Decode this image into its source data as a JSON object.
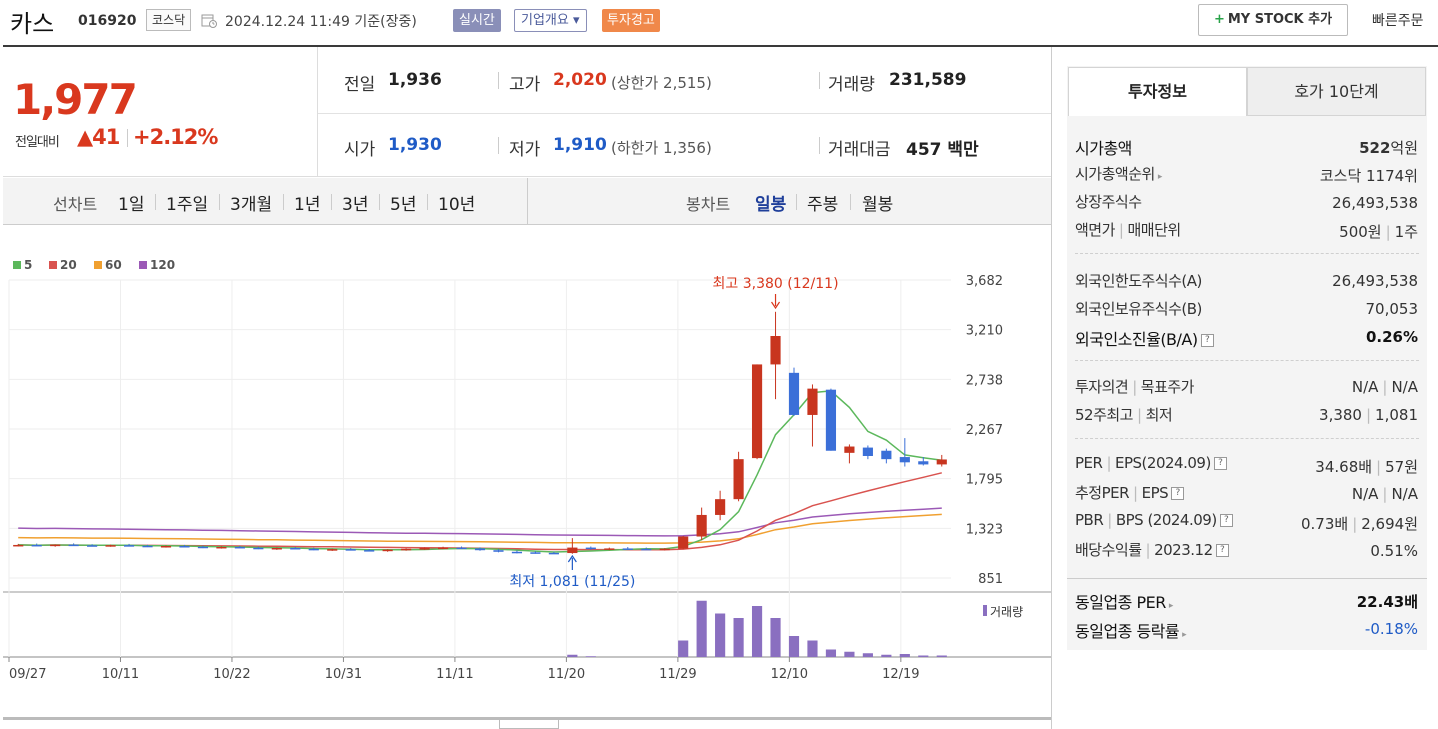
{
  "header": {
    "company_name": "카스",
    "company_code": "016920",
    "market": "코스닥",
    "datetime": "2024.12.24 11:49  기준(장중)",
    "realtime_label": "실시간",
    "overview_label": "기업개요 ▾",
    "warning_label": "투자경고",
    "mystock_label": "MY STOCK 추가",
    "quick_order_label": "빠른주문"
  },
  "price": {
    "current": "1,977",
    "change_label": "전일대비",
    "change_amount": "▲41",
    "change_percent": "+2.12%",
    "prev_close_label": "전일",
    "prev_close": "1,936",
    "high_label": "고가",
    "high": "2,020",
    "upper_limit": "(상한가 2,515)",
    "volume_label": "거래량",
    "volume": "231,589",
    "open_label": "시가",
    "open": "1,930",
    "low_label": "저가",
    "low": "1,910",
    "lower_limit": "(하한가 1,356)",
    "amount_label": "거래대금",
    "amount": "457 백만"
  },
  "chart_tabs": {
    "line_label": "선차트",
    "periods": [
      "1일",
      "1주일",
      "3개월",
      "1년",
      "3년",
      "5년",
      "10년"
    ],
    "candle_label": "봉차트",
    "candle_periods": [
      "일봉",
      "주봉",
      "월봉"
    ],
    "active_candle": "일봉"
  },
  "chart_data": {
    "type": "candlestick",
    "legend": [
      {
        "name": "5",
        "color": "#5cb85c"
      },
      {
        "name": "20",
        "color": "#d9534f"
      },
      {
        "name": "60",
        "color": "#f0a030"
      },
      {
        "name": "120",
        "color": "#9b59b6"
      }
    ],
    "y_ticks": [
      "3,682",
      "3,210",
      "2,738",
      "2,267",
      "1,795",
      "1,323",
      "851"
    ],
    "ylim": [
      851,
      3682
    ],
    "x_ticks": [
      "09/27",
      "10/11",
      "10/22",
      "10/31",
      "11/11",
      "11/20",
      "11/29",
      "12/10",
      "12/19"
    ],
    "annotation_high": "최고 3,380 (12/11)",
    "annotation_low": "최저 1,081 (11/25)",
    "volume_label": "거래량",
    "candles": [
      [
        1160,
        1175,
        1150,
        1165
      ],
      [
        1165,
        1178,
        1155,
        1160
      ],
      [
        1160,
        1170,
        1148,
        1168
      ],
      [
        1168,
        1180,
        1160,
        1162
      ],
      [
        1162,
        1172,
        1150,
        1158
      ],
      [
        1158,
        1168,
        1148,
        1163
      ],
      [
        1163,
        1175,
        1155,
        1157
      ],
      [
        1157,
        1166,
        1145,
        1150
      ],
      [
        1150,
        1160,
        1140,
        1155
      ],
      [
        1155,
        1165,
        1145,
        1148
      ],
      [
        1148,
        1158,
        1135,
        1142
      ],
      [
        1142,
        1152,
        1130,
        1146
      ],
      [
        1146,
        1156,
        1136,
        1138
      ],
      [
        1138,
        1148,
        1125,
        1130
      ],
      [
        1130,
        1140,
        1118,
        1136
      ],
      [
        1136,
        1145,
        1125,
        1128
      ],
      [
        1128,
        1138,
        1115,
        1120
      ],
      [
        1120,
        1130,
        1108,
        1125
      ],
      [
        1125,
        1135,
        1112,
        1116
      ],
      [
        1116,
        1126,
        1105,
        1112
      ],
      [
        1112,
        1125,
        1100,
        1120
      ],
      [
        1120,
        1132,
        1110,
        1128
      ],
      [
        1128,
        1140,
        1118,
        1135
      ],
      [
        1135,
        1148,
        1125,
        1140
      ],
      [
        1140,
        1150,
        1128,
        1132
      ],
      [
        1132,
        1142,
        1110,
        1115
      ],
      [
        1115,
        1125,
        1095,
        1100
      ],
      [
        1100,
        1112,
        1085,
        1095
      ],
      [
        1095,
        1105,
        1082,
        1090
      ],
      [
        1090,
        1100,
        1081,
        1088
      ],
      [
        1088,
        1230,
        1081,
        1140
      ],
      [
        1140,
        1150,
        1120,
        1125
      ],
      [
        1125,
        1140,
        1115,
        1132
      ],
      [
        1132,
        1145,
        1120,
        1128
      ],
      [
        1128,
        1140,
        1118,
        1122
      ],
      [
        1122,
        1135,
        1112,
        1130
      ],
      [
        1130,
        1250,
        1125,
        1245
      ],
      [
        1245,
        1520,
        1210,
        1450
      ],
      [
        1450,
        1680,
        1400,
        1600
      ],
      [
        1600,
        2050,
        1580,
        1980
      ],
      [
        1990,
        2880,
        1980,
        2880
      ],
      [
        2880,
        3380,
        2550,
        3150
      ],
      [
        2800,
        2850,
        2390,
        2400
      ],
      [
        2400,
        2690,
        2100,
        2650
      ],
      [
        2640,
        2650,
        2060,
        2060
      ],
      [
        2040,
        2120,
        1940,
        2100
      ],
      [
        2090,
        2110,
        1980,
        2010
      ],
      [
        2060,
        2080,
        1940,
        1980
      ],
      [
        2000,
        2180,
        1910,
        1950
      ],
      [
        1960,
        2000,
        1920,
        1930
      ],
      [
        1930,
        2020,
        1910,
        1977
      ]
    ],
    "volumes": [
      0,
      0,
      0,
      0,
      0,
      0,
      0,
      0,
      0,
      0,
      0,
      0,
      0,
      0,
      0,
      0,
      0,
      0,
      0,
      0,
      0,
      0,
      0,
      0,
      0,
      0,
      0,
      0,
      0,
      0,
      3,
      1,
      0,
      0,
      0,
      0,
      22,
      75,
      58,
      52,
      68,
      52,
      28,
      22,
      10,
      7,
      5,
      3,
      4,
      2,
      2
    ]
  },
  "info": {
    "tab_invest": "투자정보",
    "tab_hoga": "호가 10단계",
    "market_cap_label": "시가총액",
    "market_cap_num": "522",
    "market_cap_unit": "억원",
    "rank_label": "시가총액순위",
    "rank_value": "코스닥 1174위",
    "shares_label": "상장주식수",
    "shares_value": "26,493,538",
    "par_label": "액면가",
    "trade_unit_label": "매매단위",
    "par_value": "500원",
    "trade_unit_value": "1주",
    "foreign_limit_label": "외국인한도주식수(A)",
    "foreign_limit_value": "26,493,538",
    "foreign_held_label": "외국인보유주식수(B)",
    "foreign_held_value": "70,053",
    "foreign_ratio_label": "외국인소진율(B/A)",
    "foreign_ratio_value": "0.26%",
    "opinion_label": "투자의견",
    "target_label": "목표주가",
    "opinion_value": "N/A",
    "target_value": "N/A",
    "week52_label": "52주최고",
    "week52_low_label": "최저",
    "week52_high": "3,380",
    "week52_low": "1,081",
    "per_label": "PER",
    "eps_label": "EPS(2024.09)",
    "per_value": "34.68배",
    "eps_value": "57원",
    "est_per_label": "추정PER",
    "est_eps_label": "EPS",
    "est_per_value": "N/A",
    "est_eps_value": "N/A",
    "pbr_label": "PBR",
    "bps_label": "BPS (2024.09)",
    "pbr_value": "0.73배",
    "bps_value": "2,694원",
    "div_label": "배당수익률",
    "div_date": "2023.12",
    "div_value": "0.51%",
    "sector_per_label": "동일업종 PER",
    "sector_per_value": "22.43배",
    "sector_change_label": "동일업종 등락률",
    "sector_change_value": "-0.18%"
  }
}
